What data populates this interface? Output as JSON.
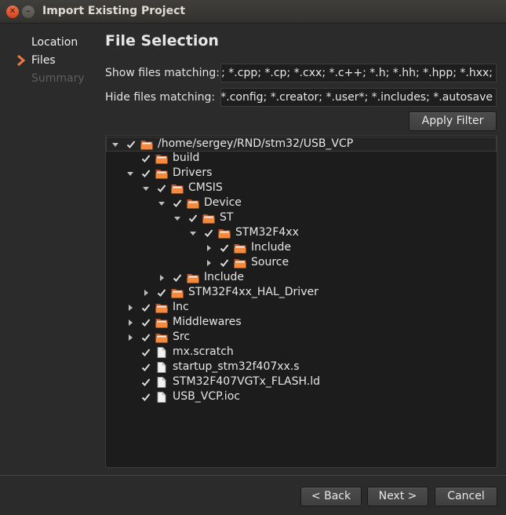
{
  "window": {
    "title": "Import Existing Project"
  },
  "sidebar": {
    "steps": [
      {
        "label": "Location",
        "state": "done"
      },
      {
        "label": "Files",
        "state": "current"
      },
      {
        "label": "Summary",
        "state": "pending"
      }
    ]
  },
  "main": {
    "title": "File Selection",
    "show_label": "Show files matching:",
    "show_value": "*.c; *.cc; *.cpp; *.cp; *.cxx; *.c++; *.h; *.hh; *.hpp; *.hxx;",
    "hide_label": "Hide files matching:",
    "hide_value": "Makefile*; *.o; *.lo; *.la; *.obj; *~; *.files; *.config; *.creator; *.user*; *.includes; *.autosave",
    "apply_filter": "Apply Filter"
  },
  "tree": [
    {
      "label": "/home/sergey/RND/stm32/USB_VCP",
      "depth": 0,
      "expander": "open",
      "type": "folder",
      "checked": true
    },
    {
      "label": "build",
      "depth": 1,
      "expander": "none",
      "type": "folder",
      "checked": true
    },
    {
      "label": "Drivers",
      "depth": 1,
      "expander": "open",
      "type": "folder",
      "checked": true
    },
    {
      "label": "CMSIS",
      "depth": 2,
      "expander": "open",
      "type": "folder",
      "checked": true
    },
    {
      "label": "Device",
      "depth": 3,
      "expander": "open",
      "type": "folder",
      "checked": true
    },
    {
      "label": "ST",
      "depth": 4,
      "expander": "open",
      "type": "folder",
      "checked": true
    },
    {
      "label": "STM32F4xx",
      "depth": 5,
      "expander": "open",
      "type": "folder",
      "checked": true
    },
    {
      "label": "Include",
      "depth": 6,
      "expander": "closed",
      "type": "folder",
      "checked": true
    },
    {
      "label": "Source",
      "depth": 6,
      "expander": "closed",
      "type": "folder",
      "checked": true
    },
    {
      "label": "Include",
      "depth": 3,
      "expander": "closed",
      "type": "folder",
      "checked": true
    },
    {
      "label": "STM32F4xx_HAL_Driver",
      "depth": 2,
      "expander": "closed",
      "type": "folder",
      "checked": true
    },
    {
      "label": "Inc",
      "depth": 1,
      "expander": "closed",
      "type": "folder",
      "checked": true
    },
    {
      "label": "Middlewares",
      "depth": 1,
      "expander": "closed",
      "type": "folder",
      "checked": true
    },
    {
      "label": "Src",
      "depth": 1,
      "expander": "closed",
      "type": "folder",
      "checked": true
    },
    {
      "label": "mx.scratch",
      "depth": 1,
      "expander": "none",
      "type": "file",
      "checked": true
    },
    {
      "label": "startup_stm32f407xx.s",
      "depth": 1,
      "expander": "none",
      "type": "file",
      "checked": true
    },
    {
      "label": "STM32F407VGTx_FLASH.ld",
      "depth": 1,
      "expander": "none",
      "type": "file",
      "checked": true
    },
    {
      "label": "USB_VCP.ioc",
      "depth": 1,
      "expander": "none",
      "type": "file",
      "checked": true
    }
  ],
  "footer": {
    "back_label": "< Back",
    "next_label": "Next >",
    "cancel_label": "Cancel"
  },
  "colors": {
    "accent": "#f07746",
    "folder": "#f58a3c"
  }
}
